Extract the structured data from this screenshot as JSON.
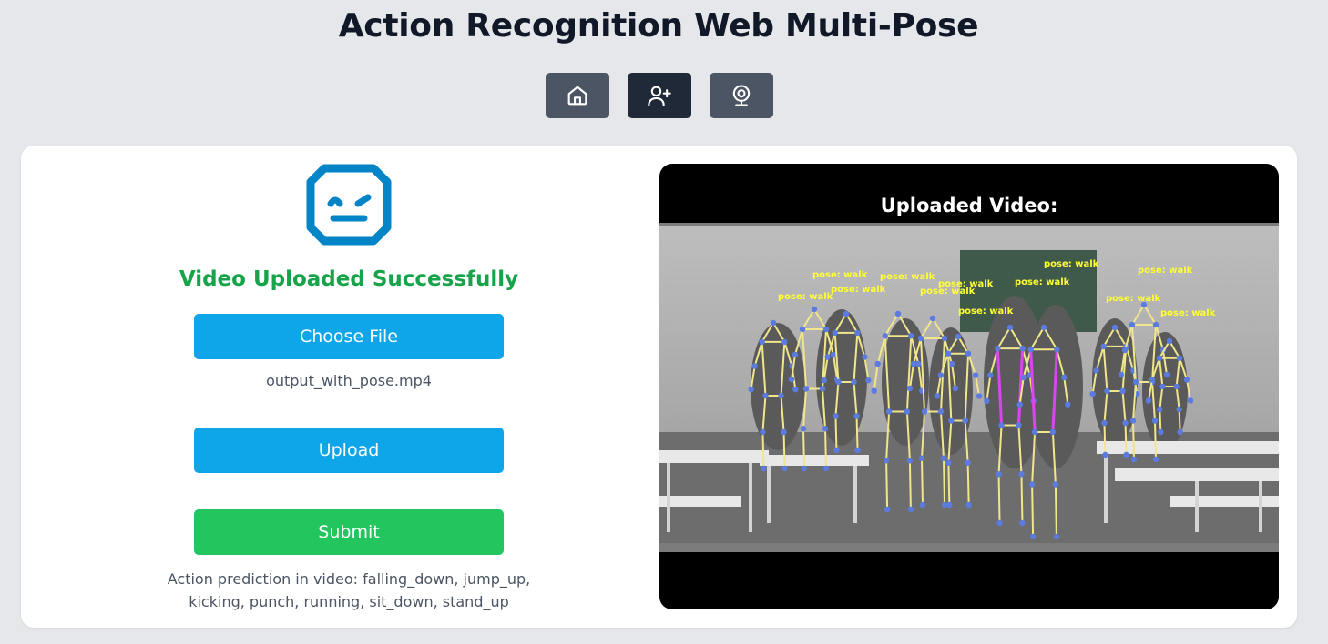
{
  "header": {
    "title": "Action Recognition Web Multi-Pose"
  },
  "nav": {
    "items": [
      {
        "icon": "home-icon",
        "active": false
      },
      {
        "icon": "user-plus-icon",
        "active": true
      },
      {
        "icon": "webcam-icon",
        "active": false
      }
    ]
  },
  "upload": {
    "status_text": "Video Uploaded Successfully",
    "choose_file_label": "Choose File",
    "file_name": "output_with_pose.mp4",
    "upload_label": "Upload",
    "submit_label": "Submit",
    "prediction_text": "Action prediction in video: falling_down, jump_up, kicking, punch, running, sit_down, stand_up"
  },
  "video": {
    "title": "Uploaded Video:",
    "pose_label": "pose: walk"
  },
  "colors": {
    "page_bg": "#e5e7eb",
    "nav_button": "#4b5563",
    "nav_button_active": "#1f2937",
    "logo_blue": "#0284c7",
    "success_green": "#16a34a",
    "button_blue": "#0ea5e9",
    "button_green": "#22c55e",
    "skeleton_yellow": "#f0e68c",
    "keypoint_blue": "#5b7be0",
    "skeleton_magenta": "#d946ef"
  }
}
